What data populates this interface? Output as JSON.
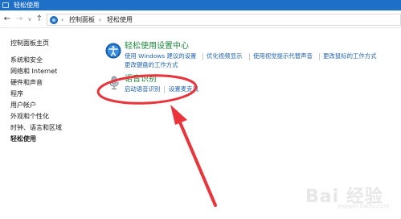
{
  "window": {
    "title": "轻松使用"
  },
  "nav": {
    "back": "←",
    "forward": "→",
    "dropdown": "∨",
    "up": "↑",
    "breadcrumbs": [
      "控制面板",
      "轻松使用"
    ],
    "separator": "›"
  },
  "sidebar": {
    "items": [
      {
        "label": "控制面板主页"
      },
      {
        "label": "系统和安全"
      },
      {
        "label": "网络和 Internet"
      },
      {
        "label": "硬件和声音"
      },
      {
        "label": "程序"
      },
      {
        "label": "用户帐户"
      },
      {
        "label": "外观和个性化"
      },
      {
        "label": "时钟、语言和区域"
      },
      {
        "label": "轻松使用"
      }
    ]
  },
  "main": {
    "ease_center": {
      "title": "轻松使用设置中心",
      "links": [
        "使用 Windows 建议的设置",
        "优化视频显示",
        "使用视觉提示代替声音",
        "更改鼠标的工作方式",
        "更改键盘的工作方式"
      ]
    },
    "speech": {
      "title": "语音识别",
      "links": [
        "启动语音识别",
        "设置麦克风"
      ]
    }
  },
  "watermark": {
    "text": "Bai 经验",
    "sub": "jingyan.baidu.com"
  },
  "colors": {
    "titlebar": "#1e6fc8",
    "section_title": "#1e8a3e",
    "link": "#1f63b3",
    "annotation": "#e8343a"
  }
}
